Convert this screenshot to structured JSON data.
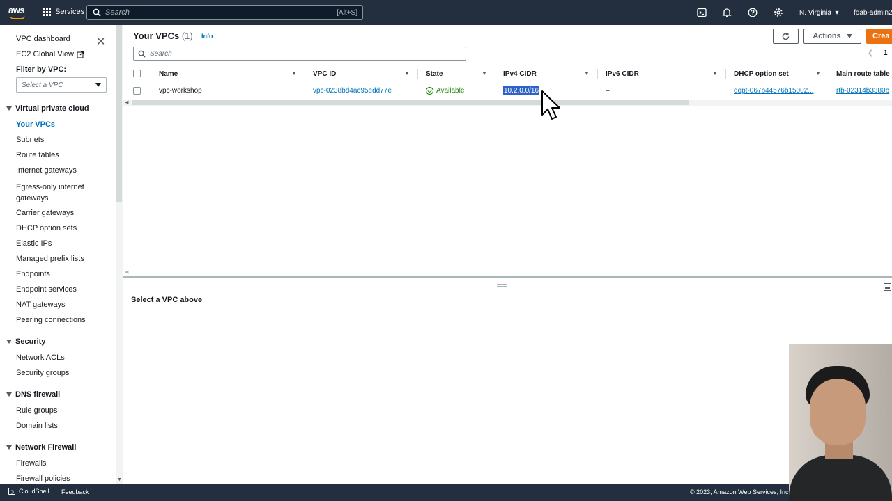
{
  "topbar": {
    "logo_text": "aws",
    "services_label": "Services",
    "search_placeholder": "Search",
    "search_shortcut": "[Alt+S]",
    "region": "N. Virginia",
    "account": "foab-admin2"
  },
  "sidebar": {
    "dashboard": "VPC dashboard",
    "global_view": "EC2 Global View",
    "filter_label": "Filter by VPC:",
    "filter_placeholder": "Select a VPC",
    "sections": {
      "vpc": "Virtual private cloud",
      "security": "Security",
      "dns_firewall": "DNS firewall",
      "network_firewall": "Network Firewall"
    },
    "items": {
      "your_vpcs": "Your VPCs",
      "subnets": "Subnets",
      "route_tables": "Route tables",
      "internet_gateways": "Internet gateways",
      "egress_line1": "Egress-only internet",
      "egress_line2": "gateways",
      "carrier_gateways": "Carrier gateways",
      "dhcp_option_sets": "DHCP option sets",
      "elastic_ips": "Elastic IPs",
      "managed_prefix_lists": "Managed prefix lists",
      "endpoints": "Endpoints",
      "endpoint_services": "Endpoint services",
      "nat_gateways": "NAT gateways",
      "peering_connections": "Peering connections",
      "network_acls": "Network ACLs",
      "security_groups": "Security groups",
      "rule_groups": "Rule groups",
      "domain_lists": "Domain lists",
      "firewalls": "Firewalls",
      "firewall_policies": "Firewall policies"
    }
  },
  "main": {
    "title": "Your VPCs",
    "count": "(1)",
    "info": "Info",
    "actions_label": "Actions",
    "create_label": "Crea",
    "search_placeholder": "Search",
    "page_number": "1",
    "columns": {
      "name": "Name",
      "vpc_id": "VPC ID",
      "state": "State",
      "ipv4": "IPv4 CIDR",
      "ipv6": "IPv6 CIDR",
      "dhcp": "DHCP option set",
      "main_route": "Main route table"
    },
    "row": {
      "name": "vpc-workshop",
      "vpc_id": "vpc-0238bd4ac95edd77e",
      "state": "Available",
      "ipv4": "10.2.0.0/16",
      "ipv6": "–",
      "dhcp": "dopt-067b44576b15002...",
      "main_route": "rtb-02314b3380b"
    },
    "detail_message": "Select a VPC above"
  },
  "footer": {
    "cloudshell": "CloudShell",
    "feedback": "Feedback",
    "copyright": "© 2023, Amazon Web Services, Inc."
  },
  "icons": {
    "search": "search-icon",
    "terminal": "cloudshell-icon",
    "bell": "notifications-icon",
    "help": "help-icon",
    "settings": "gear-icon",
    "refresh": "refresh-icon",
    "external": "external-link-icon",
    "cursor": "mouse-cursor-icon"
  },
  "colors": {
    "nav_bg": "#232f3e",
    "link": "#0073bb",
    "primary": "#ec7211",
    "success": "#1d8102",
    "selection": "#2f62c8"
  }
}
